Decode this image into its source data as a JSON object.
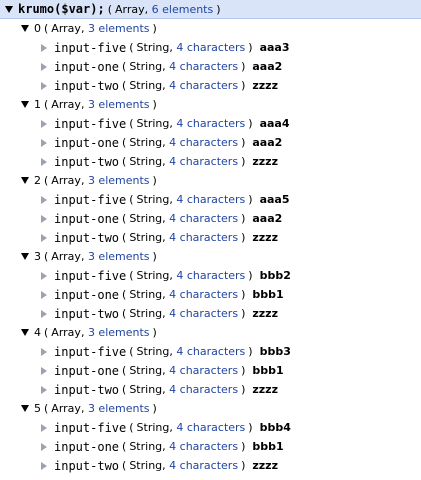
{
  "root": {
    "name": "krumo($var);",
    "type": "Array",
    "count_text": "6 elements"
  },
  "items": [
    {
      "key": "0",
      "type": "Array",
      "count_text": "3 elements",
      "children": [
        {
          "key": "input-five",
          "type": "String",
          "length_text": "4 characters",
          "value": "aaa3"
        },
        {
          "key": "input-one",
          "type": "String",
          "length_text": "4 characters",
          "value": "aaa2"
        },
        {
          "key": "input-two",
          "type": "String",
          "length_text": "4 characters",
          "value": "zzzz"
        }
      ]
    },
    {
      "key": "1",
      "type": "Array",
      "count_text": "3 elements",
      "children": [
        {
          "key": "input-five",
          "type": "String",
          "length_text": "4 characters",
          "value": "aaa4"
        },
        {
          "key": "input-one",
          "type": "String",
          "length_text": "4 characters",
          "value": "aaa2"
        },
        {
          "key": "input-two",
          "type": "String",
          "length_text": "4 characters",
          "value": "zzzz"
        }
      ]
    },
    {
      "key": "2",
      "type": "Array",
      "count_text": "3 elements",
      "children": [
        {
          "key": "input-five",
          "type": "String",
          "length_text": "4 characters",
          "value": "aaa5"
        },
        {
          "key": "input-one",
          "type": "String",
          "length_text": "4 characters",
          "value": "aaa2"
        },
        {
          "key": "input-two",
          "type": "String",
          "length_text": "4 characters",
          "value": "zzzz"
        }
      ]
    },
    {
      "key": "3",
      "type": "Array",
      "count_text": "3 elements",
      "children": [
        {
          "key": "input-five",
          "type": "String",
          "length_text": "4 characters",
          "value": "bbb2"
        },
        {
          "key": "input-one",
          "type": "String",
          "length_text": "4 characters",
          "value": "bbb1"
        },
        {
          "key": "input-two",
          "type": "String",
          "length_text": "4 characters",
          "value": "zzzz"
        }
      ]
    },
    {
      "key": "4",
      "type": "Array",
      "count_text": "3 elements",
      "children": [
        {
          "key": "input-five",
          "type": "String",
          "length_text": "4 characters",
          "value": "bbb3"
        },
        {
          "key": "input-one",
          "type": "String",
          "length_text": "4 characters",
          "value": "bbb1"
        },
        {
          "key": "input-two",
          "type": "String",
          "length_text": "4 characters",
          "value": "zzzz"
        }
      ]
    },
    {
      "key": "5",
      "type": "Array",
      "count_text": "3 elements",
      "children": [
        {
          "key": "input-five",
          "type": "String",
          "length_text": "4 characters",
          "value": "bbb4"
        },
        {
          "key": "input-one",
          "type": "String",
          "length_text": "4 characters",
          "value": "bbb1"
        },
        {
          "key": "input-two",
          "type": "String",
          "length_text": "4 characters",
          "value": "zzzz"
        }
      ]
    }
  ]
}
